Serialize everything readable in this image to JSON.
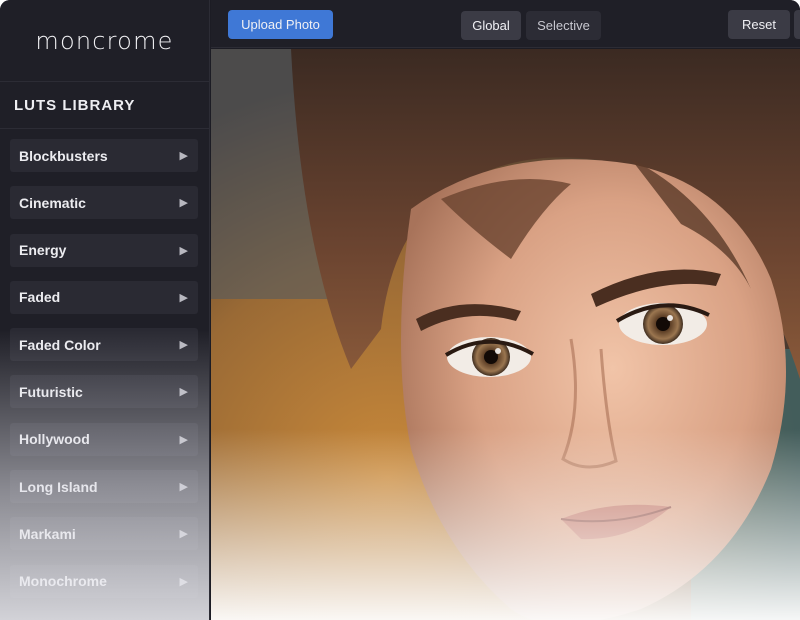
{
  "brand": {
    "name": "moncrome"
  },
  "sidebar": {
    "title": "LUTS LIBRARY",
    "items": [
      {
        "label": "Blockbusters"
      },
      {
        "label": "Cinematic"
      },
      {
        "label": "Energy"
      },
      {
        "label": "Faded"
      },
      {
        "label": "Faded Color"
      },
      {
        "label": "Futuristic"
      },
      {
        "label": "Hollywood"
      },
      {
        "label": "Long Island"
      },
      {
        "label": "Markami"
      },
      {
        "label": "Monochrome"
      }
    ],
    "expand_icon": "triangle-right-icon"
  },
  "toolbar": {
    "upload_label": "Upload Photo",
    "mode_global_label": "Global",
    "mode_selective_label": "Selective",
    "active_mode": "Global",
    "reset_label": "Reset"
  },
  "colors": {
    "accent": "#3f78d6",
    "panel": "#1f1f27",
    "item": "#2a2a33"
  }
}
